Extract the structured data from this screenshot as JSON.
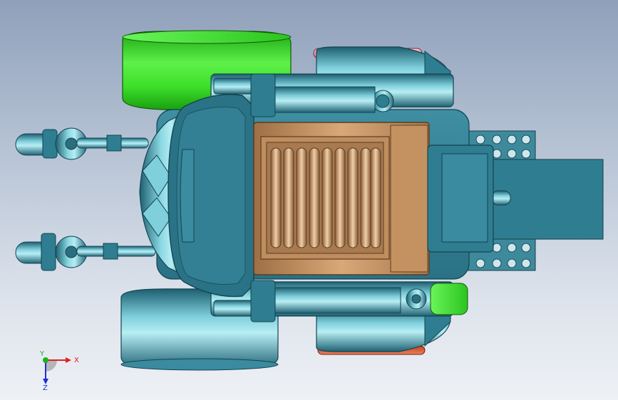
{
  "viewport": {
    "background_top": "#8fa0ba",
    "background_bottom": "#eef1f5"
  },
  "triad": {
    "x_label": "X",
    "y_label": "Y",
    "z_label": "Z",
    "x_color": "#e02020",
    "y_color": "#20b020",
    "z_color": "#2030d0"
  },
  "model": {
    "body_color": "#2f7f95",
    "highlight_color": "#9fdfe8",
    "wheel_green": "#33ee22",
    "radiator_color": "#c49260",
    "pink_accent": "#e88aa0",
    "orange_accent": "#e05a3a"
  }
}
